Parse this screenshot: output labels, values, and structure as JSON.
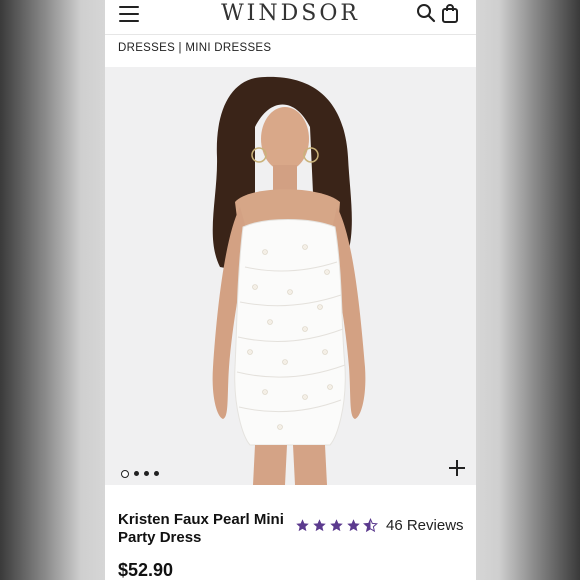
{
  "header": {
    "logo": "WINDSOR",
    "menu_icon": "hamburger-menu-icon",
    "search_icon": "search-icon",
    "bag_icon": "shopping-bag-icon"
  },
  "breadcrumb": "DRESSES | MINI DRESSES",
  "gallery": {
    "image_count": 4,
    "active_index": 0,
    "expand_icon": "plus-icon"
  },
  "product": {
    "name": "Kristen Faux Pearl Mini Party Dress",
    "rating": 4.5,
    "rating_max": 5,
    "reviews": "46 Reviews",
    "price": "$52.90"
  },
  "colors": {
    "star": "#5b3a8e",
    "text": "#111111"
  }
}
